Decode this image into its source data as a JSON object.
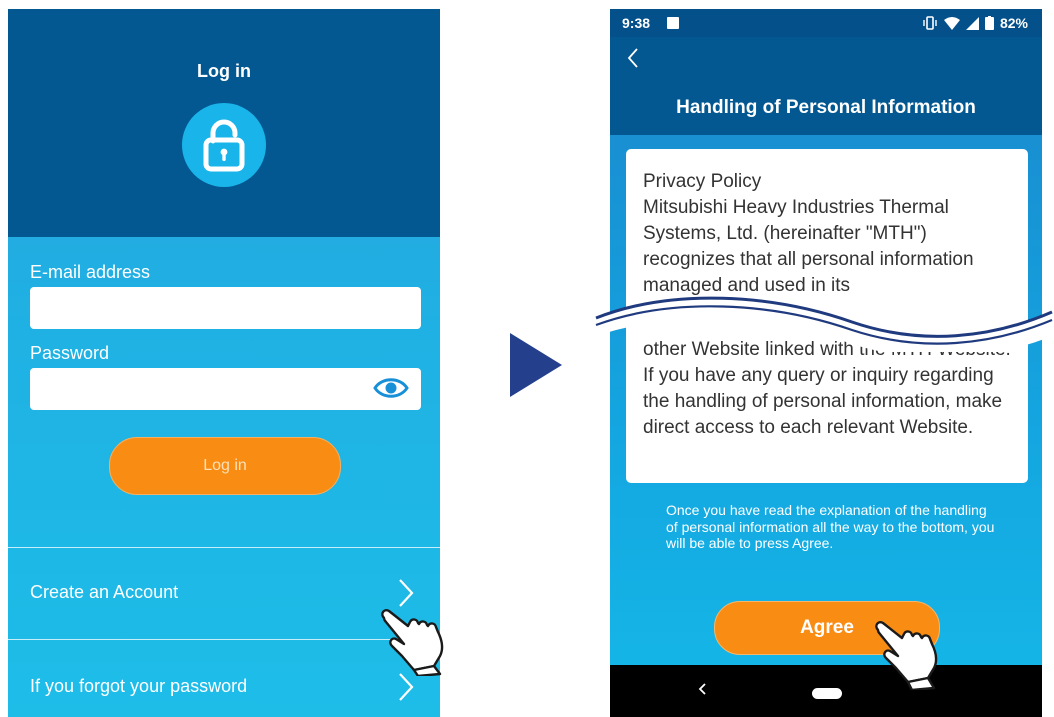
{
  "login": {
    "title": "Log in",
    "email_label": "E-mail address",
    "email_value": "",
    "password_label": "Password",
    "password_value": "",
    "login_button": "Log in",
    "create_account": "Create an Account",
    "forgot_password": "If you forgot your password"
  },
  "status": {
    "time": "9:38",
    "battery": "82%"
  },
  "privacy": {
    "title": "Handling of Personal Information",
    "text_top": "Privacy Policy\nMitsubishi Heavy Industries Thermal Systems, Ltd. (hereinafter \"MTH\") recognizes that all personal information managed and used in its",
    "text_bottom": "other Website linked with the MTH Website. If you have any query or inquiry regarding the handling of personal information, make direct access to each relevant Website.",
    "note": "Once you have read the explanation of the handling of personal information all the way to the bottom, you will be able to press Agree.",
    "agree_button": "Agree"
  },
  "icons": {
    "lock": "unlocked-padlock-icon",
    "eye": "eye-icon",
    "chevron": "chevron-right-icon",
    "back": "back-arrow-icon",
    "hand": "pointing-hand-icon",
    "arrow": "flow-arrow-icon"
  },
  "colors": {
    "header_blue": "#035891",
    "accent_orange": "#f98c13",
    "light_blue": "#1fb1e3"
  }
}
